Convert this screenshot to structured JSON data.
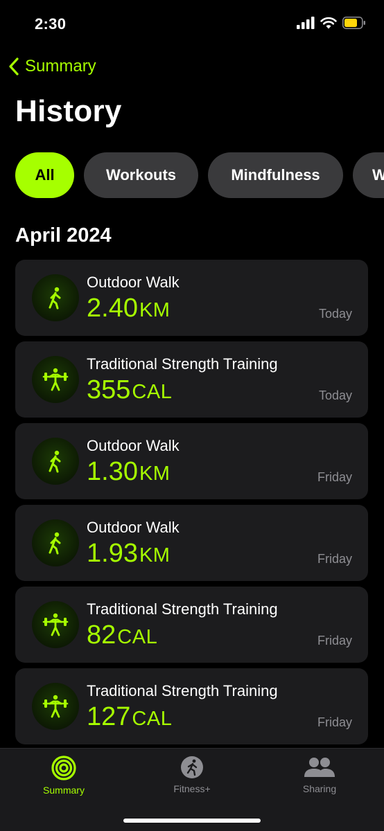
{
  "status_bar": {
    "time": "2:30"
  },
  "header": {
    "back_label": "Summary",
    "title": "History"
  },
  "filters": [
    {
      "label": "All",
      "active": true
    },
    {
      "label": "Workouts",
      "active": false
    },
    {
      "label": "Mindfulness",
      "active": false
    },
    {
      "label": "W",
      "active": false
    }
  ],
  "section": {
    "title": "April 2024"
  },
  "workouts": [
    {
      "title": "Outdoor Walk",
      "value": "2.40",
      "unit": "KM",
      "date": "Today",
      "icon": "walk-icon"
    },
    {
      "title": "Traditional Strength Training",
      "value": "355",
      "unit": "CAL",
      "date": "Today",
      "icon": "strength-training-icon"
    },
    {
      "title": "Outdoor Walk",
      "value": "1.30",
      "unit": "KM",
      "date": "Friday",
      "icon": "walk-icon"
    },
    {
      "title": "Outdoor Walk",
      "value": "1.93",
      "unit": "KM",
      "date": "Friday",
      "icon": "walk-icon"
    },
    {
      "title": "Traditional Strength Training",
      "value": "82",
      "unit": "CAL",
      "date": "Friday",
      "icon": "strength-training-icon"
    },
    {
      "title": "Traditional Strength Training",
      "value": "127",
      "unit": "CAL",
      "date": "Friday",
      "icon": "strength-training-icon"
    }
  ],
  "tab_bar": {
    "tabs": [
      {
        "label": "Summary",
        "icon": "activity-rings-icon",
        "active": true
      },
      {
        "label": "Fitness+",
        "icon": "fitness-plus-icon",
        "active": false
      },
      {
        "label": "Sharing",
        "icon": "sharing-icon",
        "active": false
      }
    ]
  },
  "colors": {
    "accent": "#a6ff00",
    "card_bg": "#1c1c1e",
    "secondary_text": "#8e8e93"
  }
}
